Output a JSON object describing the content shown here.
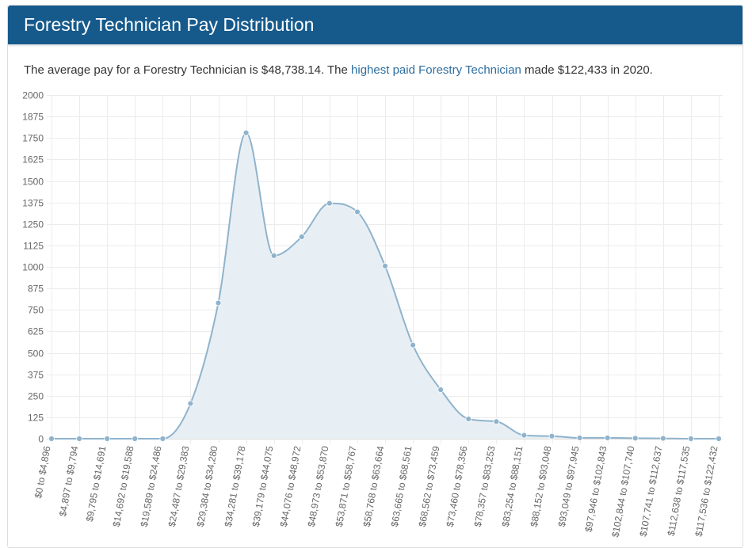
{
  "header": {
    "title": "Forestry Technician Pay Distribution"
  },
  "summary": {
    "part1": "The average pay for a Forestry Technician is $48,738.14. The ",
    "link_text": "highest paid Forestry Technician",
    "part2": " made $122,433 in 2020."
  },
  "colors": {
    "header_bg": "#165a8c",
    "line": "#8fb3cc",
    "fill": "#e8eff4",
    "point": "#8fb3cc",
    "link": "#2f6e9f"
  },
  "chart_data": {
    "type": "area",
    "title": "",
    "xlabel": "",
    "ylabel": "",
    "ylim": [
      0,
      2000
    ],
    "yticks": [
      0,
      125,
      250,
      375,
      500,
      625,
      750,
      875,
      1000,
      1125,
      1250,
      1375,
      1500,
      1625,
      1750,
      1875,
      2000
    ],
    "grid": true,
    "categories": [
      "$0 to $4,896",
      "$4,897 to $9,794",
      "$9,795 to $14,691",
      "$14,692 to $19,588",
      "$19,589 to $24,486",
      "$24,487 to $29,383",
      "$29,384 to $34,280",
      "$34,281 to $39,178",
      "$39,179 to $44,075",
      "$44,076 to $48,972",
      "$48,973 to $53,870",
      "$53,871 to $58,767",
      "$58,768 to $63,664",
      "$63,665 to $68,561",
      "$68,562 to $73,459",
      "$73,460 to $78,356",
      "$78,357 to $83,253",
      "$83,254 to $88,151",
      "$88,152 to $93,048",
      "$93,049 to $97,945",
      "$97,946 to $102,843",
      "$102,844 to $107,740",
      "$107,741 to $112,637",
      "$112,638 to $117,535",
      "$117,536 to $122,432"
    ],
    "values": [
      0,
      0,
      0,
      0,
      0,
      205,
      790,
      1780,
      1065,
      1175,
      1370,
      1320,
      1005,
      545,
      285,
      115,
      100,
      20,
      15,
      5,
      5,
      3,
      2,
      0,
      0
    ]
  }
}
